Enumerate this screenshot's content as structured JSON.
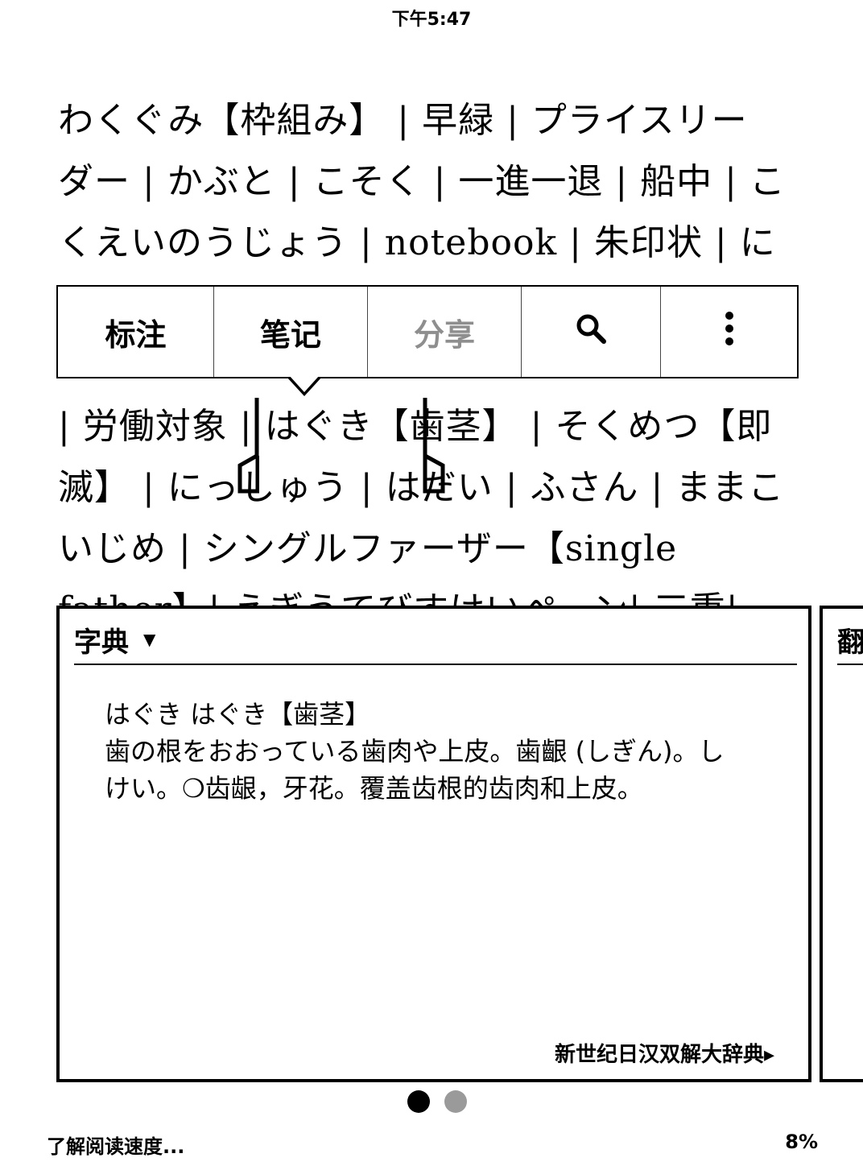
{
  "status": {
    "time": "下午5:47"
  },
  "reader": {
    "lines": [
      "わくぐみ【枠組み】 | 早緑 | プライスリー",
      "ダー | かぶと | こそく | 一進一退 | 船中 | こ",
      "くえいのうじょう | notebook | 朱印状 | に",
      "",
      "",
      "| 労働対象 | はぐき【歯茎】 | そくめつ【即",
      "滅】 | にっしゅう | はだい | ふさん | ままこ",
      "いじめ | シングルファーザー【single",
      "father】| えぎうてびすけいぺーン| 三重|"
    ],
    "selected_word": "歯茎"
  },
  "popup_menu": {
    "annotate_label": "标注",
    "note_label": "笔记",
    "share_label": "分享",
    "search_icon": "search-icon",
    "more_icon": "more-vertical-icon"
  },
  "dictionary": {
    "header_label": "字典",
    "headword": "はぐき はぐき【歯茎】",
    "definition": "歯の根をおおっている歯肉や上皮。歯齦 (しぎん)。しけい。❍齿龈，牙花。覆盖齿根的齿肉和上皮。",
    "source": "新世纪日汉双解大辞典▸"
  },
  "next_card": {
    "title": "翻"
  },
  "pager": {
    "active_index": 0,
    "count": 2
  },
  "footer": {
    "reading_speed": "了解阅读速度...",
    "progress": "8%"
  }
}
